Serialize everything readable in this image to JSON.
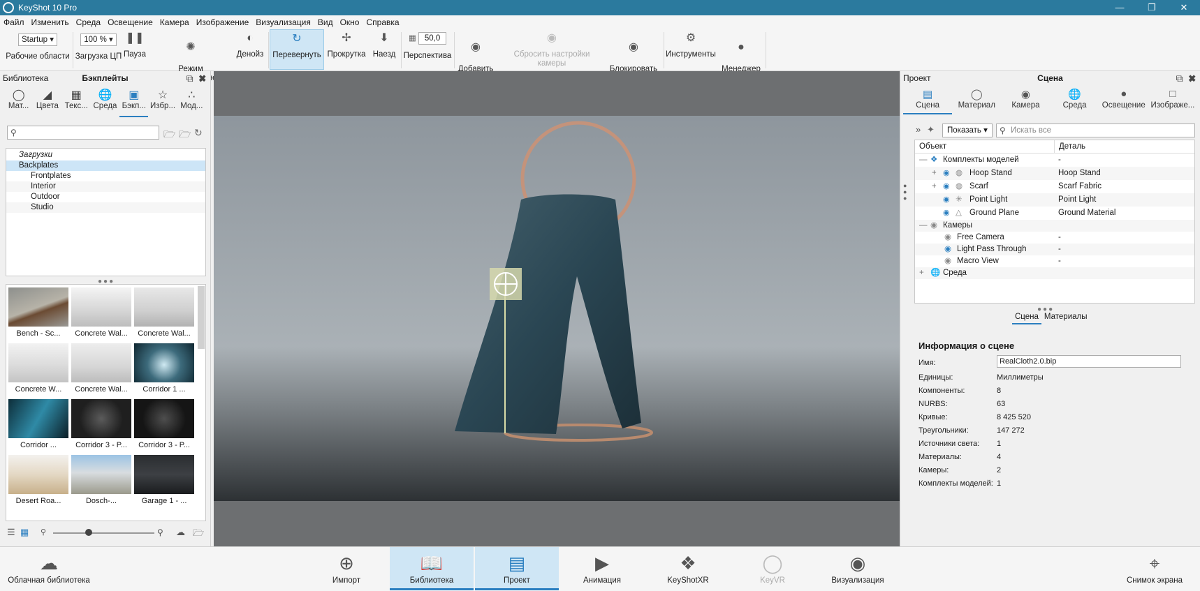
{
  "window": {
    "title": "KeyShot 10 Pro"
  },
  "menu": [
    "Файл",
    "Изменить",
    "Среда",
    "Освещение",
    "Камера",
    "Изображение",
    "Визуализация",
    "Вид",
    "Окно",
    "Справка"
  ],
  "toolbar": {
    "workspace_value": "Startup",
    "workspace_label": "Рабочие области",
    "cpu_value": "100 %",
    "cpu_label": "Загрузка ЦП",
    "pause": "Пауза",
    "perf_mode": "Режим\nпроизводительности",
    "denoise": "Денойз",
    "flip": "Перевернуть",
    "scroll": "Прокрутка",
    "dolly": "Наезд",
    "perspective_value": "50,0",
    "perspective": "Перспектива",
    "add_camera": "Добавить\nкамеру",
    "reset_camera": "Сбросить настройки камеры",
    "lock_camera": "Блокировать\nкамеру",
    "tools": "Инструменты",
    "light_manager": "Менеджер\nсвета"
  },
  "library": {
    "header_left": "Библиотека",
    "header_title": "Бэкплейты",
    "tabs": [
      "Мат...",
      "Цвета",
      "Текс...",
      "Среда",
      "Бэкп...",
      "Избр...",
      "Мод..."
    ],
    "tree": [
      "Загрузки",
      "Backplates",
      "Frontplates",
      "Interior",
      "Outdoor",
      "Studio"
    ],
    "thumbs": [
      "Bench - Sc...",
      "Concrete Wal...",
      "Concrete Wal...",
      "Concrete W...",
      "Concrete Wal...",
      "Corridor 1 ...",
      "Corridor ...",
      "Corridor 3 - P...",
      "Corridor 3 - P...",
      "Desert Roa...",
      "Dosch-...",
      "Garage 1 - ..."
    ]
  },
  "project": {
    "header_left": "Проект",
    "header_title": "Сцена",
    "tabs": [
      "Сцена",
      "Материал",
      "Камера",
      "Среда",
      "Освещение",
      "Изображе..."
    ],
    "show_label": "Показать",
    "search_placeholder": "Искать все",
    "col_object": "Объект",
    "col_detail": "Деталь",
    "rows": [
      {
        "name": "Комплекты моделей",
        "detail": "-"
      },
      {
        "name": "Hoop Stand",
        "detail": "Hoop Stand"
      },
      {
        "name": "Scarf",
        "detail": "Scarf Fabric"
      },
      {
        "name": "Point Light",
        "detail": "Point Light"
      },
      {
        "name": "Ground Plane",
        "detail": "Ground Material"
      },
      {
        "name": "Камеры",
        "detail": ""
      },
      {
        "name": "Free Camera",
        "detail": "-"
      },
      {
        "name": "Light Pass Through",
        "detail": "-"
      },
      {
        "name": "Macro View",
        "detail": "-"
      },
      {
        "name": "Среда",
        "detail": ""
      }
    ],
    "subtabs": [
      "Сцена",
      "Материалы"
    ],
    "info_title": "Информация о сцене",
    "info": [
      {
        "k": "Имя:",
        "v": "RealCloth2.0.bip"
      },
      {
        "k": "Единицы:",
        "v": "Миллиметры"
      },
      {
        "k": "Компоненты:",
        "v": "8"
      },
      {
        "k": "NURBS:",
        "v": "63"
      },
      {
        "k": "Кривые:",
        "v": "8 425 520"
      },
      {
        "k": "Треугольники:",
        "v": "147 272"
      },
      {
        "k": "Источники света:",
        "v": "1"
      },
      {
        "k": "Материалы:",
        "v": "4"
      },
      {
        "k": "Камеры:",
        "v": "2"
      },
      {
        "k": "Комплекты моделей:",
        "v": "1"
      }
    ]
  },
  "bottom": {
    "cloud": "Облачная библиотека",
    "import": "Импорт",
    "library": "Библиотека",
    "project": "Проект",
    "animation": "Анимация",
    "keyshotxr": "KeyShotXR",
    "keyvr": "KeyVR",
    "render": "Визуализация",
    "screenshot": "Снимок экрана"
  }
}
